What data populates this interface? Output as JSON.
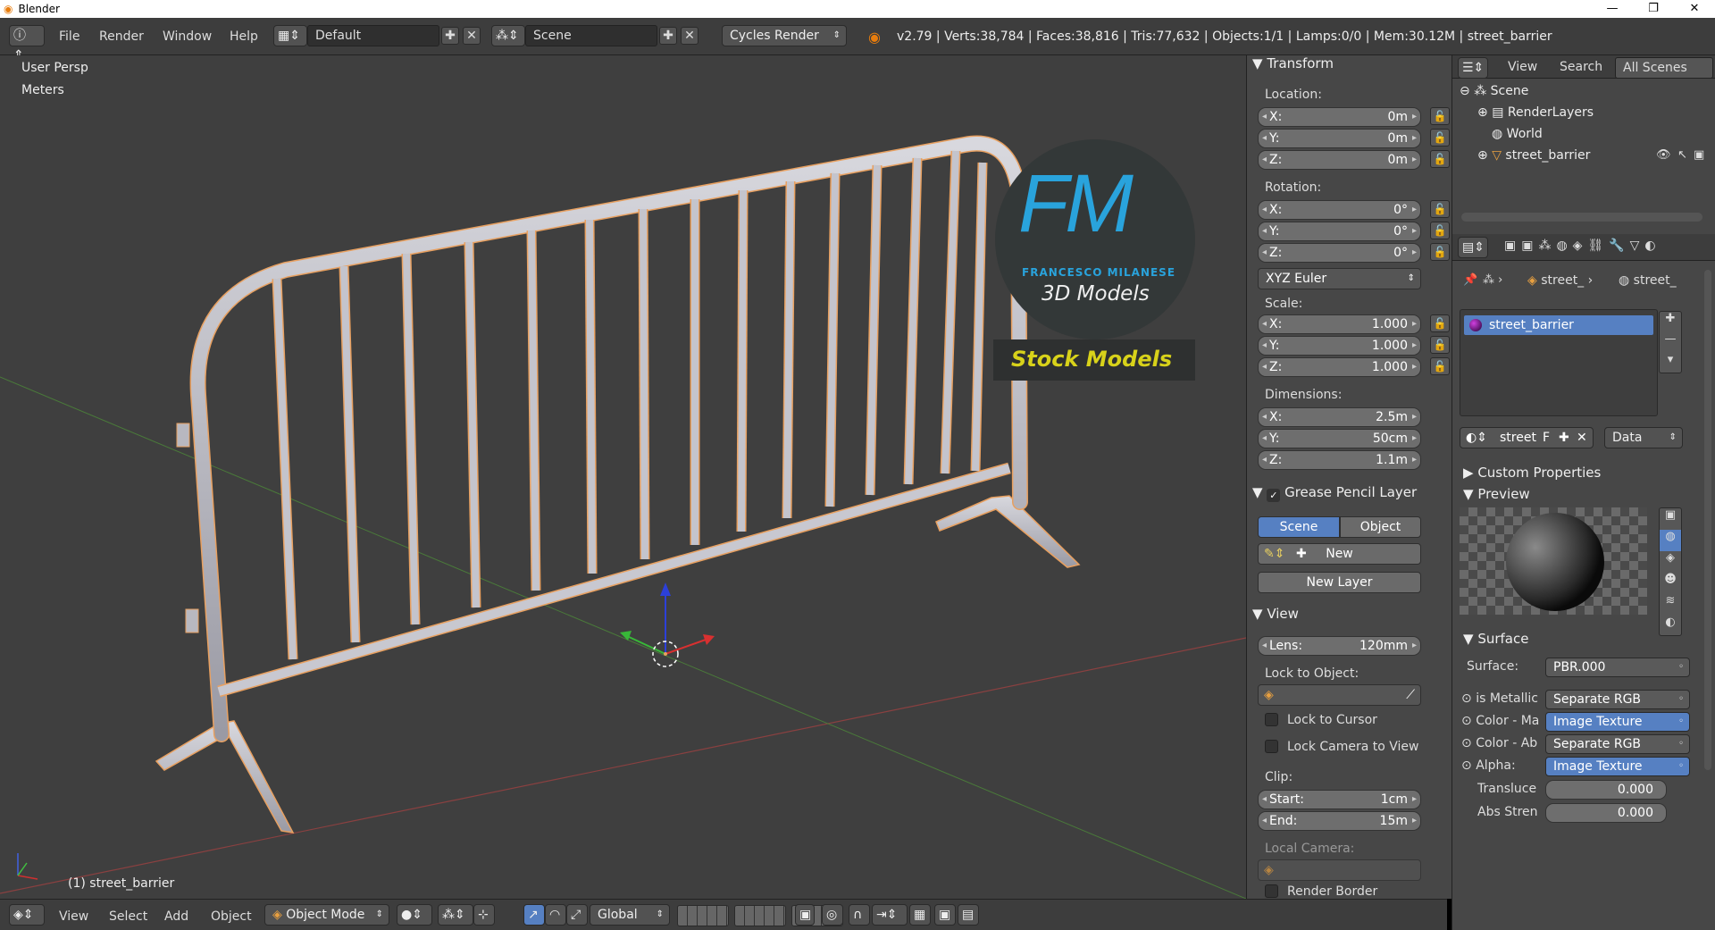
{
  "window": {
    "title": "Blender",
    "minimize": "—",
    "restore": "❐",
    "close": "✕"
  },
  "topbar": {
    "menus": [
      "File",
      "Render",
      "Window",
      "Help"
    ],
    "layout": "Default",
    "scene": "Scene",
    "engine": "Cycles Render",
    "stats": "v2.79 | Verts:38,784 | Faces:38,816 | Tris:77,632 | Objects:1/1 | Lamps:0/0 | Mem:30.12M | street_barrier"
  },
  "viewport": {
    "persp": "User Persp",
    "units": "Meters",
    "object_label": "(1) street_barrier",
    "watermark_initials": "FM",
    "watermark_name": "FRANCESCO MILANESE",
    "watermark_sub": "3D Models",
    "watermark_stock": "Stock Models"
  },
  "bottombar": {
    "menus": [
      "View",
      "Select",
      "Add",
      "Object"
    ],
    "mode": "Object Mode",
    "orientation": "Global"
  },
  "npanel": {
    "transform_title": "Transform",
    "location_label": "Location:",
    "location": [
      {
        "axis": "X:",
        "value": "0m"
      },
      {
        "axis": "Y:",
        "value": "0m"
      },
      {
        "axis": "Z:",
        "value": "0m"
      }
    ],
    "rotation_label": "Rotation:",
    "rotation": [
      {
        "axis": "X:",
        "value": "0°"
      },
      {
        "axis": "Y:",
        "value": "0°"
      },
      {
        "axis": "Z:",
        "value": "0°"
      }
    ],
    "rotation_mode": "XYZ Euler",
    "scale_label": "Scale:",
    "scale": [
      {
        "axis": "X:",
        "value": "1.000"
      },
      {
        "axis": "Y:",
        "value": "1.000"
      },
      {
        "axis": "Z:",
        "value": "1.000"
      }
    ],
    "dimensions_label": "Dimensions:",
    "dimensions": [
      {
        "axis": "X:",
        "value": "2.5m"
      },
      {
        "axis": "Y:",
        "value": "50cm"
      },
      {
        "axis": "Z:",
        "value": "1.1m"
      }
    ],
    "grease_title": "Grease Pencil Layer",
    "scene_tab": "Scene",
    "object_tab": "Object",
    "new_btn": "New",
    "new_layer_btn": "New Layer",
    "view_title": "View",
    "lens_label": "Lens:",
    "lens_value": "120mm",
    "lock_object_label": "Lock to Object:",
    "lock_cursor": "Lock to Cursor",
    "lock_camera": "Lock Camera to View",
    "clip_label": "Clip:",
    "clip_start_label": "Start:",
    "clip_start": "1cm",
    "clip_end_label": "End:",
    "clip_end": "15m",
    "local_camera": "Local Camera:",
    "render_border": "Render Border"
  },
  "outliner": {
    "view": "View",
    "search": "Search",
    "filter": "All Scenes",
    "items": [
      "Scene",
      "RenderLayers",
      "World",
      "street_barrier"
    ]
  },
  "properties": {
    "breadcrumb1": "street_",
    "breadcrumb2": "street_",
    "material_slot": "street_barrier",
    "datablock_name": "street",
    "datablock_f": "F",
    "link": "Data",
    "custom_props": "Custom Properties",
    "preview": "Preview",
    "surface_title": "Surface",
    "surface_label": "Surface:",
    "surface_value": "PBR.000",
    "inputs": [
      {
        "label": "is Metallic",
        "value": "Separate RGB"
      },
      {
        "label": "Color - Ma",
        "value": "Image Texture"
      },
      {
        "label": "Color - Ab",
        "value": "Separate RGB"
      },
      {
        "label": "Alpha:",
        "value": "Image Texture"
      }
    ],
    "transluce_label": "Transluce",
    "transluce_value": "0.000",
    "absstren_label": "Abs Stren",
    "absstren_value": "0.000"
  },
  "colors": {
    "accent": "#5680c2",
    "watermark_blue": "#29a3dc",
    "watermark_yellow": "#d8d21a"
  }
}
